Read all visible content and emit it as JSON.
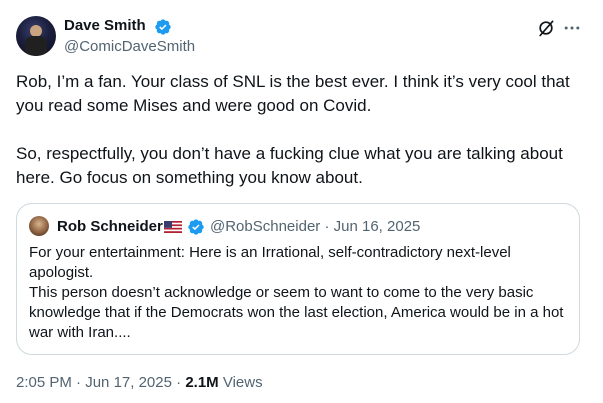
{
  "author": {
    "name": "Dave Smith",
    "handle": "@ComicDaveSmith"
  },
  "tweet": {
    "paragraph1": "Rob, I’m a fan. Your class of SNL is the best ever. I think it’s very cool that you read some Mises and were good on Covid.",
    "paragraph2": "So, respectfully, you don’t have a fucking clue what you are talking about here. Go focus on something you know about."
  },
  "quote": {
    "name": "Rob Schneider",
    "handle": "@RobSchneider",
    "separator": "·",
    "date": "Jun 16, 2025",
    "line1": "For your entertainment: Here is an Irrational, self-contradictory next-level apologist.",
    "line2": "This person doesn’t acknowledge or seem to want to come to the very basic knowledge that if the Democrats won the last election, America would be in a hot war with Iran...."
  },
  "footer": {
    "time": "2:05 PM",
    "separator": "·",
    "date": "Jun 17, 2025",
    "views_count": "2.1M",
    "views_label": "Views"
  },
  "colors": {
    "verified_blue": "#1d9bf0",
    "text_primary": "#0f1419",
    "text_secondary": "#536471",
    "border": "#cfd9de"
  },
  "icons": {
    "verified": "verified-badge-icon",
    "grok": "grok-icon",
    "more": "more-options-icon",
    "flag": "us-flag-icon"
  }
}
